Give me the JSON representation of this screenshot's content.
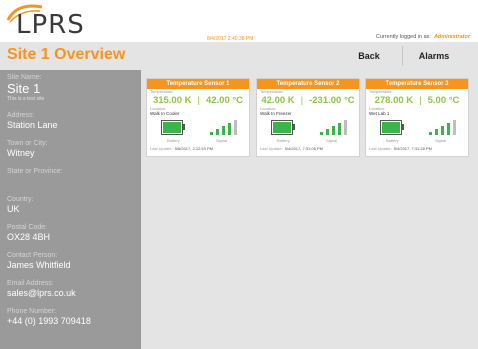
{
  "brand": {
    "name": "LPRS",
    "accent": "#f7941d"
  },
  "header": {
    "datetime": "8/4/2017 2:40:38 PM",
    "logged_in_label": "Currently logged in as:",
    "user": "Administrator"
  },
  "page": {
    "title": "Site 1 Overview"
  },
  "nav": {
    "back": "Back",
    "alarms": "Alarms"
  },
  "site": {
    "name_label": "Site Name:",
    "name": "Site 1",
    "description": "This is a test site",
    "address_label": "Address:",
    "address": "Station Lane",
    "town_label": "Town or City:",
    "town": "Witney",
    "state_label": "State or Province:",
    "state": "",
    "country_label": "Country:",
    "country": "UK",
    "postal_label": "Postal Code:",
    "postal": "OX28 4BH",
    "contact_label": "Contact Person:",
    "contact": "James Whitfield",
    "email_label": "Email Address:",
    "email": "sales@lprs.co.uk",
    "phone_label": "Phone Number:",
    "phone": "+44 (0) 1993 709418"
  },
  "labels": {
    "temperature": "Temperature:",
    "location": "Location:",
    "battery": "Battery",
    "signal": "Signal",
    "last_update": "Last Update:"
  },
  "sensors": [
    {
      "title": "Temperature Sensor 1",
      "kelvin": "315.00 K",
      "celsius": "42.00 °C",
      "location": "Walk In Cooler",
      "last_update": "5/8/2017, 2:12:53 PM",
      "battery_level": 1.0,
      "signal_bars": 4
    },
    {
      "title": "Temperature Sensor 2",
      "kelvin": "42.00 K",
      "celsius": "-231.00 °C",
      "location": "Walk In Freezer",
      "last_update": "5/4/2017, 7:31:06 PM",
      "battery_level": 1.0,
      "signal_bars": 4
    },
    {
      "title": "Temperature Sensor 3",
      "kelvin": "278.00 K",
      "celsius": "5.00 °C",
      "location": "Wet Lab 1",
      "last_update": "5/4/2017, 7:31:28 PM",
      "battery_level": 1.0,
      "signal_bars": 4
    }
  ],
  "colors": {
    "temp_value": "#8dc63f",
    "battery": "#3ab54a",
    "signal_on": "#3ab54a",
    "signal_off": "#bdbdbd"
  }
}
